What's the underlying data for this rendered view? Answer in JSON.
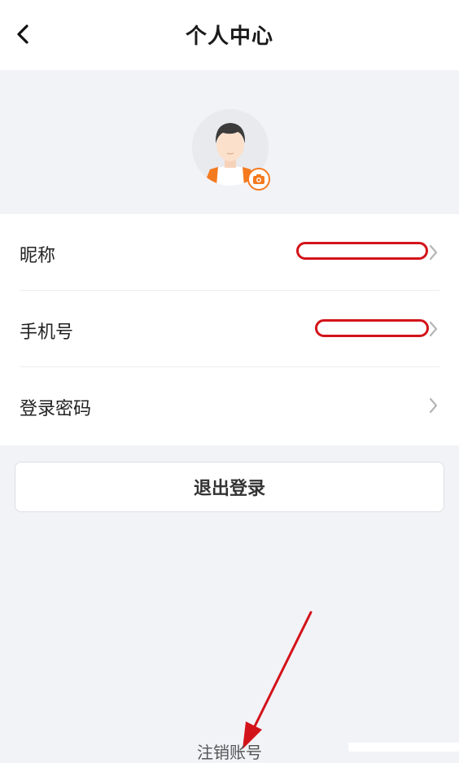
{
  "header": {
    "title": "个人中心",
    "back_icon": "chevron-left-icon"
  },
  "profile": {
    "avatar_icon": "avatar-icon",
    "camera_icon": "camera-icon",
    "accent": "#f47a1f"
  },
  "rows": [
    {
      "label": "昵称",
      "value_redacted": true
    },
    {
      "label": "手机号",
      "value_redacted": true
    },
    {
      "label": "登录密码"
    }
  ],
  "logout_label": "退出登录",
  "cancel_account_label": "注销账号",
  "annotation_color": "#d3131a"
}
